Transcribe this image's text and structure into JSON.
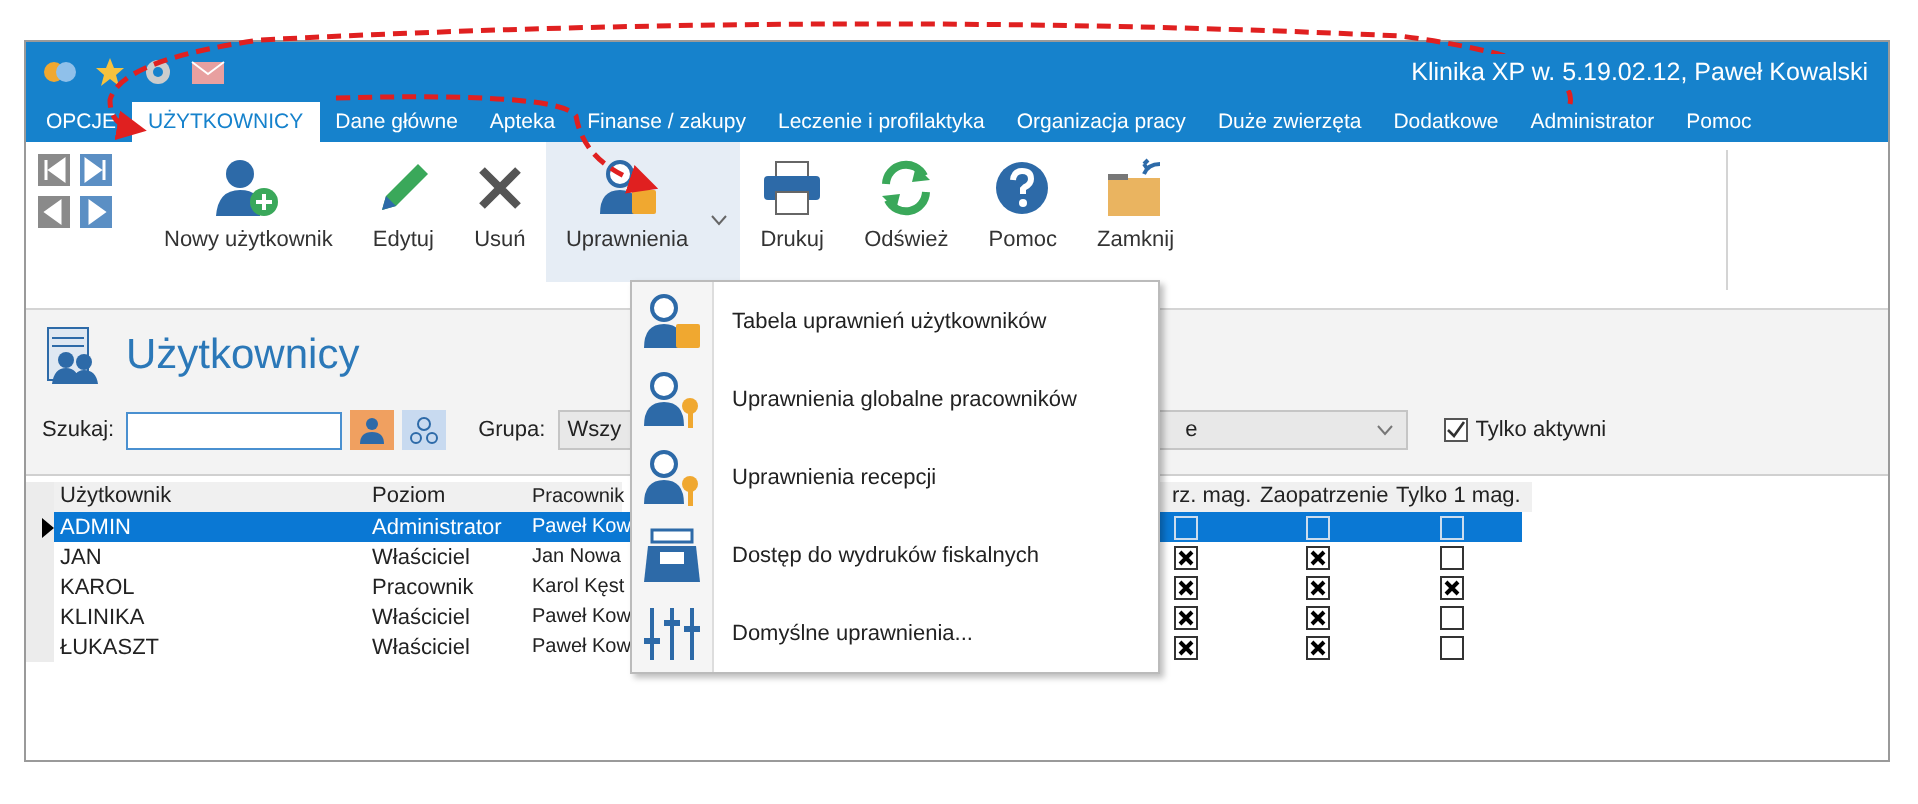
{
  "window": {
    "title": "Klinika XP w. 5.19.02.12, Paweł Kowalski"
  },
  "tabs": [
    {
      "label": "OPCJE",
      "selected": false
    },
    {
      "label": "UŻYTKOWNICY",
      "selected": true
    },
    {
      "label": "Dane główne",
      "selected": false
    },
    {
      "label": "Apteka",
      "selected": false
    },
    {
      "label": "Finanse / zakupy",
      "selected": false
    },
    {
      "label": "Leczenie i profilaktyka",
      "selected": false
    },
    {
      "label": "Organizacja pracy",
      "selected": false
    },
    {
      "label": "Duże zwierzęta",
      "selected": false
    },
    {
      "label": "Dodatkowe",
      "selected": false
    },
    {
      "label": "Administrator",
      "selected": false
    },
    {
      "label": "Pomoc",
      "selected": false
    }
  ],
  "ribbon": [
    {
      "kind": "add-user",
      "label": "Nowy użytkownik",
      "selected": false
    },
    {
      "kind": "edit",
      "label": "Edytuj",
      "selected": false
    },
    {
      "kind": "delete",
      "label": "Usuń",
      "selected": false
    },
    {
      "kind": "permissions",
      "label": "Uprawnienia",
      "selected": true
    },
    {
      "kind": "print",
      "label": "Drukuj",
      "selected": false
    },
    {
      "kind": "refresh",
      "label": "Odśwież",
      "selected": false
    },
    {
      "kind": "help",
      "label": "Pomoc",
      "selected": false
    },
    {
      "kind": "close",
      "label": "Zamknij",
      "selected": false
    }
  ],
  "section": {
    "title": "Użytkownicy"
  },
  "filters": {
    "search_label": "Szukaj:",
    "group_label": "Grupa:",
    "group_value_start": "Wszy",
    "group_value_end": "e",
    "only_active": {
      "label": "Tylko aktywni",
      "checked": true
    }
  },
  "table": {
    "columns": [
      "Użytkownik",
      "Poziom",
      "Pracownik",
      "rz. mag.",
      "Zaopatrzenie",
      "Tylko 1 mag."
    ],
    "rows": [
      {
        "user": "ADMIN",
        "level": "Administrator",
        "employee": "Paweł Kow",
        "selected": true,
        "flags": [
          {
            "checked": false
          },
          {
            "checked": false
          },
          {
            "checked": false
          }
        ]
      },
      {
        "user": "JAN",
        "level": "Właściciel",
        "employee": "Jan Nowa",
        "selected": false,
        "flags": [
          {
            "checked": true
          },
          {
            "checked": true
          },
          {
            "checked": false
          }
        ]
      },
      {
        "user": "KAROL",
        "level": "Pracownik",
        "employee": "Karol Kęst",
        "selected": false,
        "flags": [
          {
            "checked": true
          },
          {
            "checked": true
          },
          {
            "checked": true
          }
        ]
      },
      {
        "user": "KLINIKA",
        "level": "Właściciel",
        "employee": "Paweł Kow",
        "selected": false,
        "flags": [
          {
            "checked": true
          },
          {
            "checked": true
          },
          {
            "checked": false
          }
        ]
      },
      {
        "user": "ŁUKASZT",
        "level": "Właściciel",
        "employee": "Paweł Kow",
        "selected": false,
        "flags": [
          {
            "checked": true
          },
          {
            "checked": true
          },
          {
            "checked": false
          }
        ]
      }
    ]
  },
  "menu": [
    {
      "kind": "lock",
      "label": "Tabela uprawnień użytkowników"
    },
    {
      "kind": "key",
      "label": "Uprawnienia globalne pracowników"
    },
    {
      "kind": "key",
      "label": "Uprawnienia recepcji"
    },
    {
      "kind": "register",
      "label": "Dostęp do wydruków fiskalnych"
    },
    {
      "kind": "sliders",
      "label": "Domyślne uprawnienia..."
    }
  ]
}
